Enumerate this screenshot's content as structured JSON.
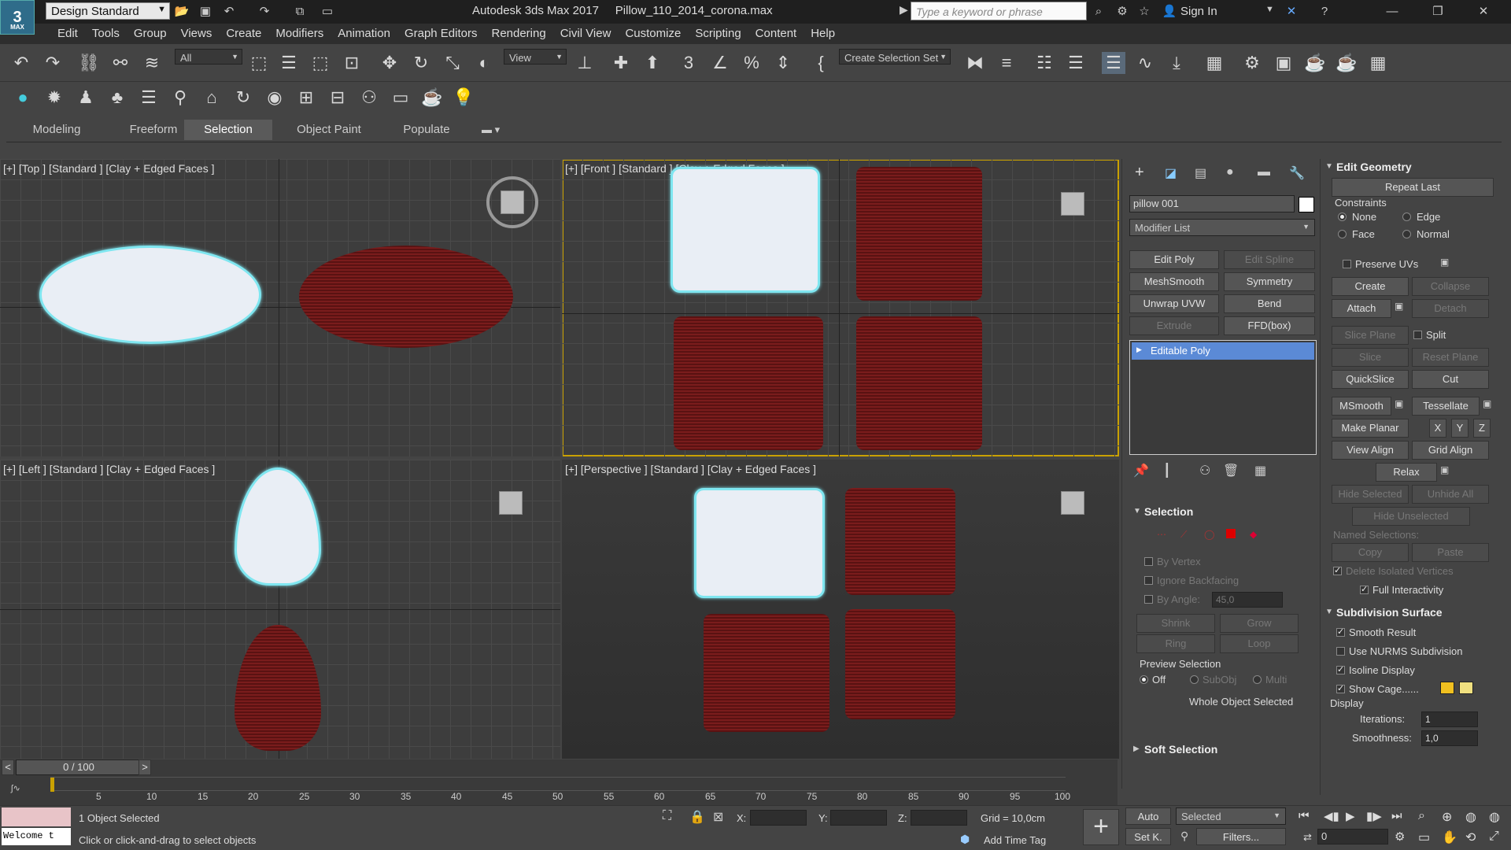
{
  "app": {
    "logo_text": "3",
    "logo_sub": "MAX",
    "workspace": "Design Standard",
    "title": "Autodesk 3ds Max 2017     Pillow_110_2014_corona.max",
    "search_placeholder": "Type a keyword or phrase",
    "sign_in": "Sign In"
  },
  "menu": [
    "Edit",
    "Tools",
    "Group",
    "Views",
    "Create",
    "Modifiers",
    "Animation",
    "Graph Editors",
    "Rendering",
    "Civil View",
    "Customize",
    "Scripting",
    "Content",
    "Help"
  ],
  "toolbar": {
    "filter_value": "All",
    "refcoord_value": "View",
    "selection_set_value": "Create Selection Set"
  },
  "ribbon_tabs": [
    "Modeling",
    "Freeform",
    "Selection",
    "Object Paint",
    "Populate"
  ],
  "viewports": {
    "top": "[+] [Top ] [Standard ] [Clay + Edged Faces ]",
    "front": "[+] [Front ] [Standard ] [Clay + Edged Faces ]",
    "left": "[+] [Left ] [Standard ] [Clay + Edged Faces ]",
    "perspective": "[+] [Perspective ] [Standard ] [Clay + Edged Faces ]"
  },
  "command_panel": {
    "object_name": "pillow 001",
    "modifier_list": "Modifier List",
    "modifier_buttons": [
      "Edit Poly",
      "Edit Spline",
      "MeshSmooth",
      "Symmetry",
      "Unwrap UVW",
      "Bend",
      "Extrude",
      "FFD(box)"
    ],
    "stack_item": "Editable Poly",
    "selection_header": "Selection",
    "by_vertex": "By Vertex",
    "ignore_backfacing": "Ignore Backfacing",
    "by_angle": "By Angle:",
    "by_angle_value": "45,0",
    "shrink": "Shrink",
    "grow": "Grow",
    "ring": "Ring",
    "loop": "Loop",
    "preview_selection": "Preview Selection",
    "preview_off": "Off",
    "preview_subobj": "SubObj",
    "preview_multi": "Multi",
    "whole_object_selected": "Whole Object Selected",
    "soft_selection": "Soft Selection"
  },
  "edit_geometry": {
    "header": "Edit Geometry",
    "repeat_last": "Repeat Last",
    "constraints": "Constraints",
    "none": "None",
    "edge": "Edge",
    "face": "Face",
    "normal": "Normal",
    "preserve_uvs": "Preserve UVs",
    "create": "Create",
    "collapse": "Collapse",
    "attach": "Attach",
    "detach": "Detach",
    "slice_plane": "Slice Plane",
    "split": "Split",
    "slice": "Slice",
    "reset_plane": "Reset Plane",
    "quickslice": "QuickSlice",
    "cut": "Cut",
    "msmooth": "MSmooth",
    "tessellate": "Tessellate",
    "make_planar": "Make Planar",
    "x": "X",
    "y": "Y",
    "z": "Z",
    "view_align": "View Align",
    "grid_align": "Grid Align",
    "relax": "Relax",
    "hide_selected": "Hide Selected",
    "unhide_all": "Unhide All",
    "hide_unselected": "Hide Unselected",
    "named_selections": "Named Selections:",
    "copy": "Copy",
    "paste": "Paste",
    "delete_isolated": "Delete Isolated Vertices",
    "full_interactivity": "Full Interactivity"
  },
  "subdivision": {
    "header": "Subdivision Surface",
    "smooth_result": "Smooth Result",
    "use_nurms": "Use NURMS Subdivision",
    "isoline": "Isoline Display",
    "show_cage": "Show Cage......",
    "display": "Display",
    "iterations_label": "Iterations:",
    "iterations": "1",
    "smoothness_label": "Smoothness:",
    "smoothness": "1,0",
    "cage_colors": [
      "#f0c020",
      "#f0e080"
    ]
  },
  "timeline": {
    "frame": "0 / 100",
    "ticks": [
      "5",
      "10",
      "15",
      "20",
      "25",
      "30",
      "35",
      "40",
      "45",
      "50",
      "55",
      "60",
      "65",
      "70",
      "75",
      "80",
      "85",
      "90",
      "95",
      "100"
    ]
  },
  "status": {
    "selected": "1 Object Selected",
    "prompt": "Click or click-and-drag to select objects",
    "welcome": "Welcome t",
    "x_label": "X:",
    "y_label": "Y:",
    "z_label": "Z:",
    "grid": "Grid = 10,0cm",
    "add_time_tag": "Add Time Tag",
    "auto": "Auto",
    "set_key": "Set K.",
    "selected_dropdown": "Selected",
    "filters": "Filters...",
    "frame_value": "0"
  }
}
